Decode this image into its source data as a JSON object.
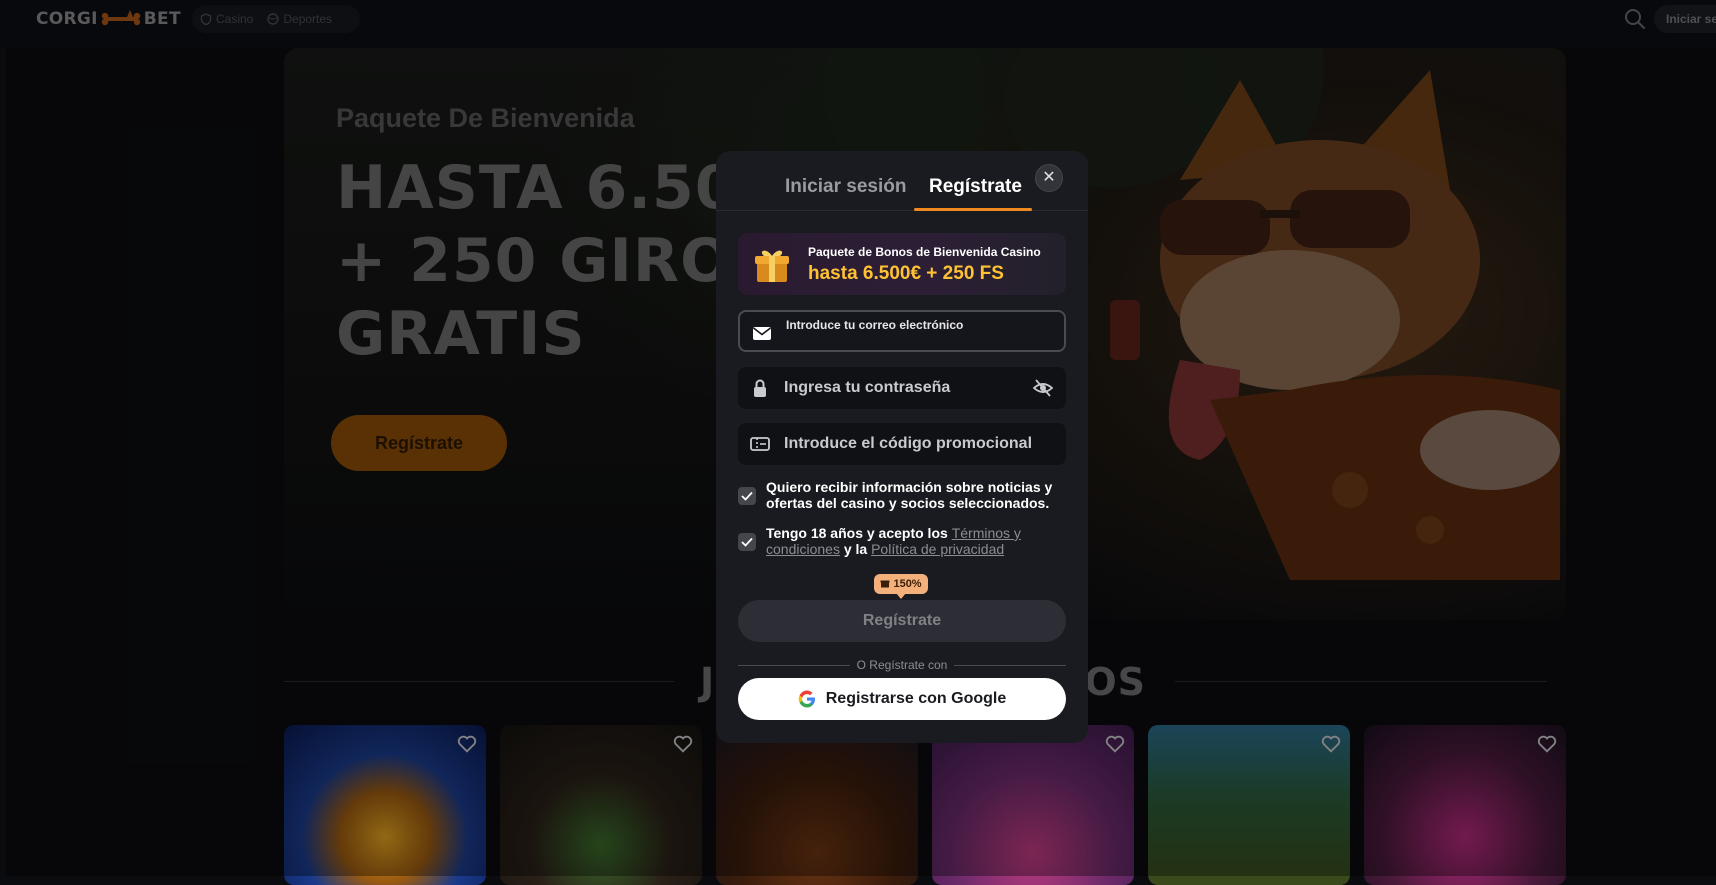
{
  "header": {
    "logo_left": "CORGI",
    "logo_right": "BET",
    "nav": [
      {
        "label": "Casino",
        "icon": "casino-icon"
      },
      {
        "label": "Deportes",
        "icon": "sports-ball-icon"
      }
    ],
    "login_label": "Iniciar sesión"
  },
  "hero": {
    "subtitle": "Paquete De Bienvenida",
    "title_line1": "HASTA 6.500",
    "title_line2": "+ 250 GIROS",
    "title_line3": "GRATIS",
    "cta": "Regístrate"
  },
  "section": {
    "title_left": "J",
    "title_right": "OS"
  },
  "modal": {
    "tabs": {
      "login": "Iniciar sesión",
      "register": "Regístrate"
    },
    "close_symbol": "✕",
    "promo": {
      "label": "Paquete de Bonos de Bienvenida Casino",
      "value": "hasta 6.500€ + 250 FS"
    },
    "email": {
      "label": "Introduce tu correo electrónico"
    },
    "password": {
      "placeholder": "Ingresa tu contraseña"
    },
    "promo_code": {
      "placeholder": "Introduce el código promocional"
    },
    "consent_news": "Quiero recibir información sobre noticias y ofertas del casino y socios seleccionados.",
    "consent_terms": {
      "prefix": "Tengo 18 años y acepto los ",
      "terms_link": "Términos y condiciones",
      "middle": " y la ",
      "privacy_link": "Política de privacidad"
    },
    "bonus_badge": "150%",
    "submit": "Regístrate",
    "divider": "O Regístrate con",
    "google": "Registrarse con Google"
  },
  "colors": {
    "accent": "#f08a20",
    "promo_value": "#ffc233",
    "modal_bg": "#1a1b21"
  }
}
